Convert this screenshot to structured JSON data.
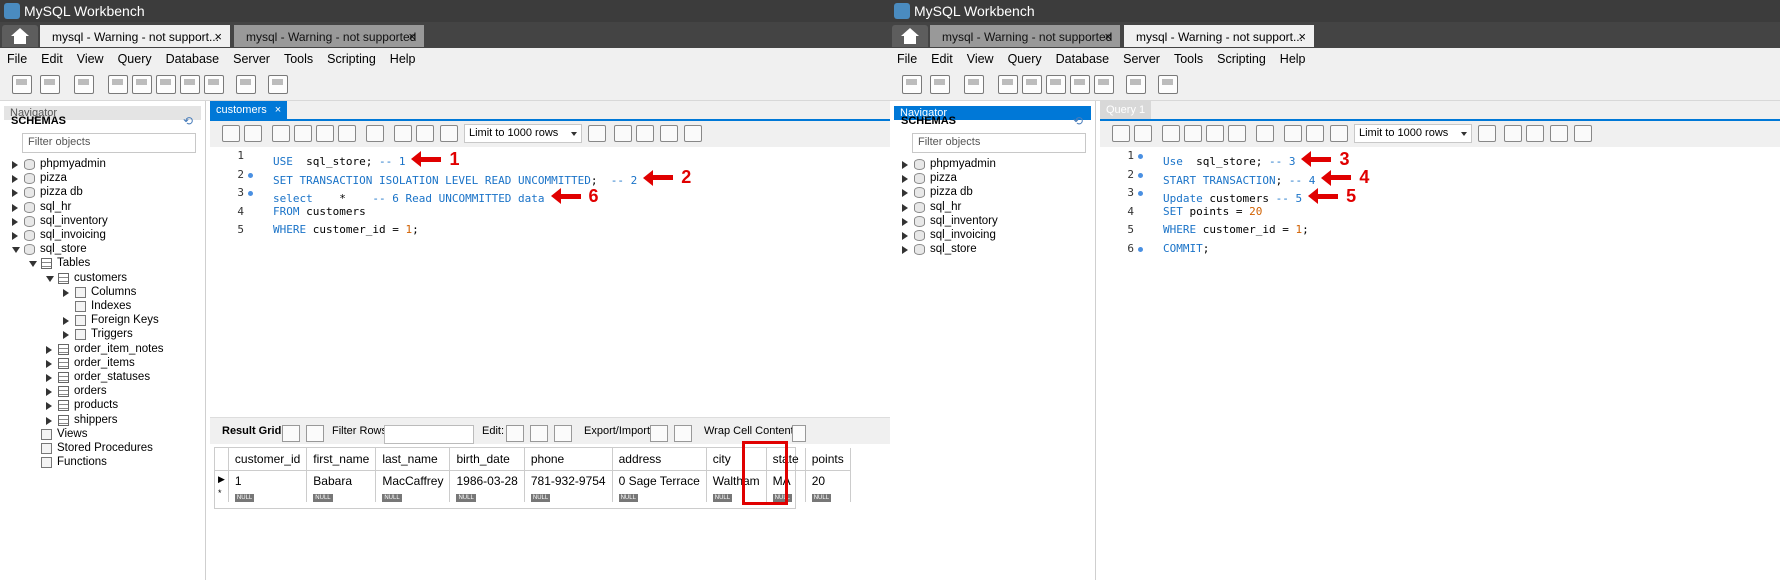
{
  "app_title": "MySQL Workbench",
  "menu": [
    "File",
    "Edit",
    "View",
    "Query",
    "Database",
    "Server",
    "Tools",
    "Scripting",
    "Help"
  ],
  "navigator": {
    "label": "Navigator",
    "schemas_label": "SCHEMAS",
    "filter_placeholder": "Filter objects"
  },
  "limit_rows": "Limit to 1000 rows",
  "left": {
    "conn_tabs": [
      {
        "label": "mysql - Warning - not support...",
        "active": true
      },
      {
        "label": "mysql - Warning - not supported",
        "active": false
      }
    ],
    "editor_tab": "customers",
    "tree": [
      {
        "label": "phpmyadmin",
        "level": 0,
        "arrow": "r",
        "icon": "db"
      },
      {
        "label": "pizza",
        "level": 0,
        "arrow": "r",
        "icon": "db"
      },
      {
        "label": "pizza db",
        "level": 0,
        "arrow": "r",
        "icon": "db"
      },
      {
        "label": "sql_hr",
        "level": 0,
        "arrow": "r",
        "icon": "db"
      },
      {
        "label": "sql_inventory",
        "level": 0,
        "arrow": "r",
        "icon": "db"
      },
      {
        "label": "sql_invoicing",
        "level": 0,
        "arrow": "r",
        "icon": "db"
      },
      {
        "label": "sql_store",
        "level": 0,
        "arrow": "d",
        "icon": "db"
      },
      {
        "label": "Tables",
        "level": 1,
        "arrow": "d",
        "icon": "tbl"
      },
      {
        "label": "customers",
        "level": 2,
        "arrow": "d",
        "icon": "tbl"
      },
      {
        "label": "Columns",
        "level": 3,
        "arrow": "r",
        "icon": "fld"
      },
      {
        "label": "Indexes",
        "level": 3,
        "arrow": "",
        "icon": "fld"
      },
      {
        "label": "Foreign Keys",
        "level": 3,
        "arrow": "r",
        "icon": "fld"
      },
      {
        "label": "Triggers",
        "level": 3,
        "arrow": "r",
        "icon": "fld"
      },
      {
        "label": "order_item_notes",
        "level": 2,
        "arrow": "r",
        "icon": "tbl"
      },
      {
        "label": "order_items",
        "level": 2,
        "arrow": "r",
        "icon": "tbl"
      },
      {
        "label": "order_statuses",
        "level": 2,
        "arrow": "r",
        "icon": "tbl"
      },
      {
        "label": "orders",
        "level": 2,
        "arrow": "r",
        "icon": "tbl"
      },
      {
        "label": "products",
        "level": 2,
        "arrow": "r",
        "icon": "tbl"
      },
      {
        "label": "shippers",
        "level": 2,
        "arrow": "r",
        "icon": "tbl"
      },
      {
        "label": "Views",
        "level": 1,
        "arrow": "",
        "icon": "fld"
      },
      {
        "label": "Stored Procedures",
        "level": 1,
        "arrow": "",
        "icon": "fld"
      },
      {
        "label": "Functions",
        "level": 1,
        "arrow": "",
        "icon": "fld"
      }
    ],
    "code_lines": [
      {
        "num": "1",
        "dot": false,
        "parts": [
          [
            "kw",
            "USE"
          ],
          [
            "",
            "  sql_store; "
          ],
          [
            "cm",
            "-- 1"
          ]
        ],
        "annot": "1"
      },
      {
        "num": "2",
        "dot": true,
        "parts": [
          [
            "kw",
            "SET TRANSACTION ISOLATION LEVEL READ UNCOMMITTED"
          ],
          [
            "",
            ";  "
          ],
          [
            "cm",
            "-- 2"
          ]
        ],
        "annot": "2"
      },
      {
        "num": "3",
        "dot": true,
        "parts": [
          [
            "kw",
            "select"
          ],
          [
            "",
            "    *    "
          ],
          [
            "cm",
            "-- 6 Read UNCOMMITTED data"
          ]
        ],
        "annot": "6"
      },
      {
        "num": "4",
        "dot": false,
        "parts": [
          [
            "kw",
            "FROM"
          ],
          [
            "",
            " customers"
          ]
        ],
        "annot": ""
      },
      {
        "num": "5",
        "dot": false,
        "parts": [
          [
            "kw",
            "WHERE"
          ],
          [
            "",
            " customer_id = "
          ],
          [
            "nm",
            "1"
          ],
          [
            "",
            ";"
          ]
        ],
        "annot": ""
      }
    ],
    "result": {
      "tab_label": "Result Grid",
      "filter_label": "Filter Rows:",
      "edit_label": "Edit:",
      "export_label": "Export/Import:",
      "wrap_label": "Wrap Cell Content:",
      "columns": [
        "customer_id",
        "first_name",
        "last_name",
        "birth_date",
        "phone",
        "address",
        "city",
        "state",
        "points"
      ],
      "row": [
        "1",
        "Babara",
        "MacCaffrey",
        "1986-03-28",
        "781-932-9754",
        "0 Sage Terrace",
        "Waltham",
        "MA",
        "20"
      ],
      "null_label": "NULL",
      "new_row_marker": "*"
    }
  },
  "right": {
    "conn_tabs": [
      {
        "label": "mysql - Warning - not supported",
        "active": false
      },
      {
        "label": "mysql - Warning - not support...",
        "active": true
      }
    ],
    "editor_tab": "Query 1",
    "tree": [
      {
        "label": "phpmyadmin",
        "level": 0,
        "arrow": "r",
        "icon": "db"
      },
      {
        "label": "pizza",
        "level": 0,
        "arrow": "r",
        "icon": "db"
      },
      {
        "label": "pizza db",
        "level": 0,
        "arrow": "r",
        "icon": "db"
      },
      {
        "label": "sql_hr",
        "level": 0,
        "arrow": "r",
        "icon": "db"
      },
      {
        "label": "sql_inventory",
        "level": 0,
        "arrow": "r",
        "icon": "db"
      },
      {
        "label": "sql_invoicing",
        "level": 0,
        "arrow": "r",
        "icon": "db"
      },
      {
        "label": "sql_store",
        "level": 0,
        "arrow": "r",
        "icon": "db"
      }
    ],
    "code_lines": [
      {
        "num": "1",
        "dot": true,
        "parts": [
          [
            "kw",
            "Use"
          ],
          [
            "",
            "  sql_store; "
          ],
          [
            "cm",
            "-- 3"
          ]
        ],
        "annot": "3"
      },
      {
        "num": "2",
        "dot": true,
        "parts": [
          [
            "kw",
            "START TRANSACTION"
          ],
          [
            "",
            "; "
          ],
          [
            "cm",
            "-- 4"
          ]
        ],
        "annot": "4"
      },
      {
        "num": "3",
        "dot": true,
        "parts": [
          [
            "kw",
            "Update"
          ],
          [
            "",
            " customers "
          ],
          [
            "cm",
            "-- 5"
          ]
        ],
        "annot": "5"
      },
      {
        "num": "4",
        "dot": false,
        "parts": [
          [
            "kw",
            "SET"
          ],
          [
            "",
            " points = "
          ],
          [
            "nm",
            "20"
          ]
        ],
        "annot": ""
      },
      {
        "num": "5",
        "dot": false,
        "parts": [
          [
            "kw",
            "WHERE"
          ],
          [
            "",
            " customer_id = "
          ],
          [
            "nm",
            "1"
          ],
          [
            "",
            ";"
          ]
        ],
        "annot": ""
      },
      {
        "num": "6",
        "dot": true,
        "parts": [
          [
            "kw",
            "COMMIT"
          ],
          [
            "",
            ";"
          ]
        ],
        "annot": ""
      }
    ]
  }
}
